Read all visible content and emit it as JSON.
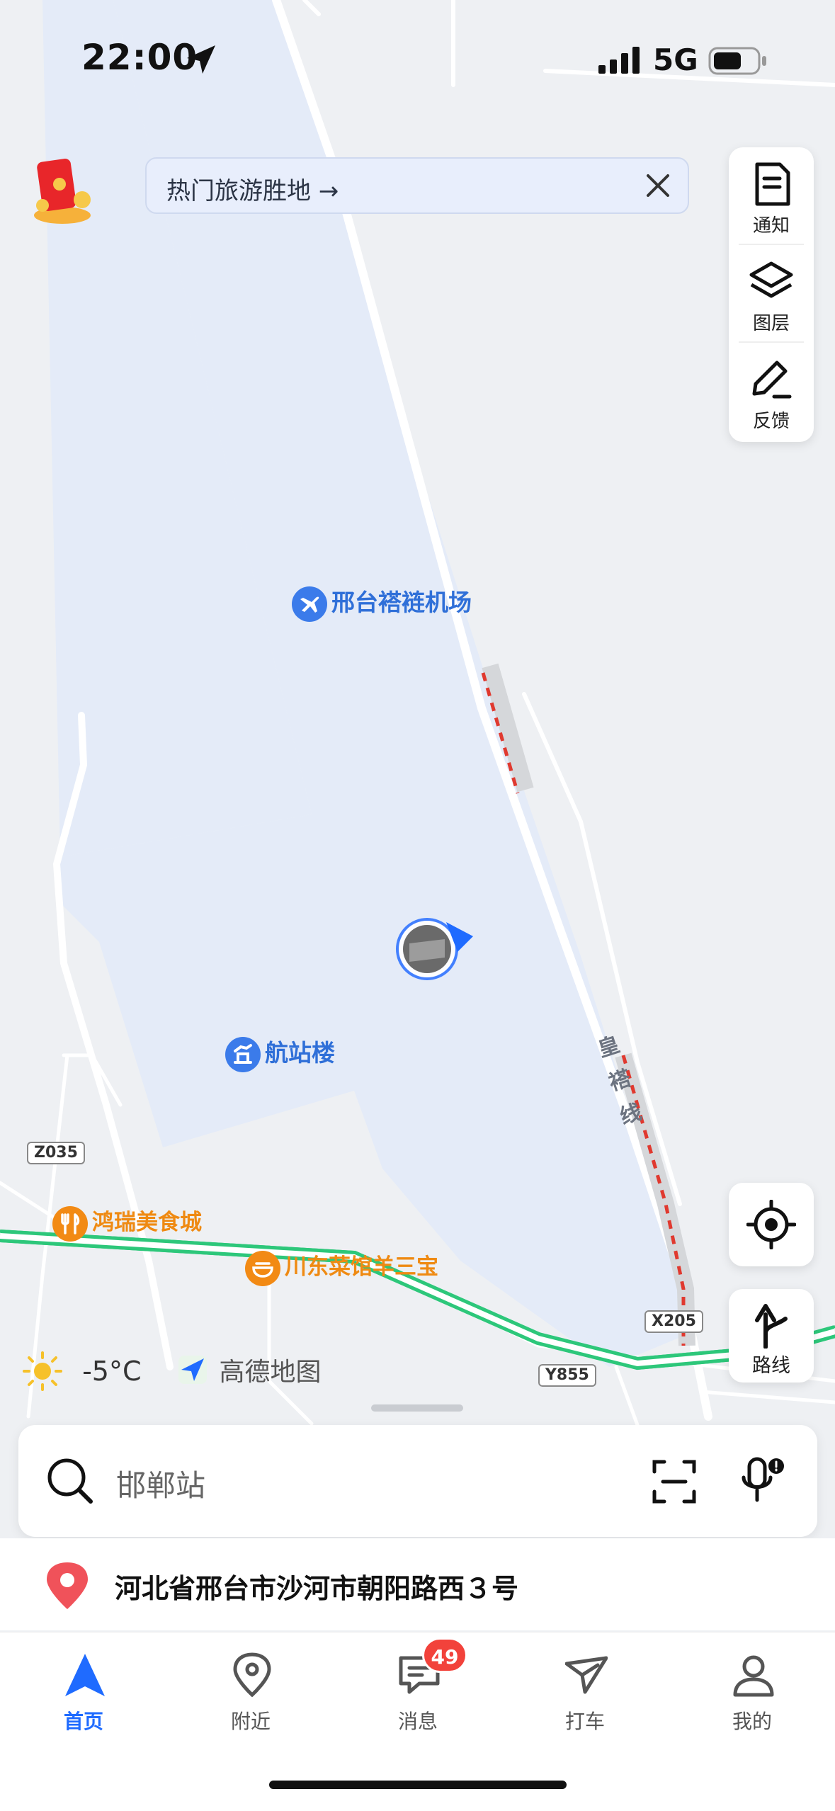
{
  "status_bar": {
    "time": "22:00",
    "network": "5G"
  },
  "promo": {
    "text": "热门旅游胜地 →"
  },
  "tools": [
    {
      "label": "通知",
      "icon": "notification-icon"
    },
    {
      "label": "图层",
      "icon": "layers-icon"
    },
    {
      "label": "反馈",
      "icon": "feedback-icon"
    }
  ],
  "route_button": {
    "label": "路线"
  },
  "map": {
    "pois": {
      "airport": "邢台褡裢机场",
      "terminal": "航站楼",
      "food_city": "鸿瑞美食城",
      "restaurant": "川东菜馆羊三宝"
    },
    "rail_line": "皇褡线",
    "road_tags": {
      "z035": "Z035",
      "x205": "X205",
      "y855": "Y855"
    },
    "colors": {
      "water_area": "#e5ecf8",
      "highway": "#2dc77a",
      "rail_dash": "#e0392f",
      "poi_blue": "#2f6fd8",
      "poi_orange": "#ef8a12"
    }
  },
  "weather": {
    "temp": "-5°C"
  },
  "brand": "高德地图",
  "search": {
    "placeholder": "邯郸站"
  },
  "address": "河北省邢台市沙河市朝阳路西３号",
  "nav": [
    {
      "label": "首页",
      "icon": "home-arrow-icon",
      "active": true
    },
    {
      "label": "附近",
      "icon": "location-pin-icon"
    },
    {
      "label": "消息",
      "icon": "message-icon",
      "badge": "49"
    },
    {
      "label": "打车",
      "icon": "taxi-icon"
    },
    {
      "label": "我的",
      "icon": "profile-icon"
    }
  ],
  "accent_color": "#1f6bff"
}
